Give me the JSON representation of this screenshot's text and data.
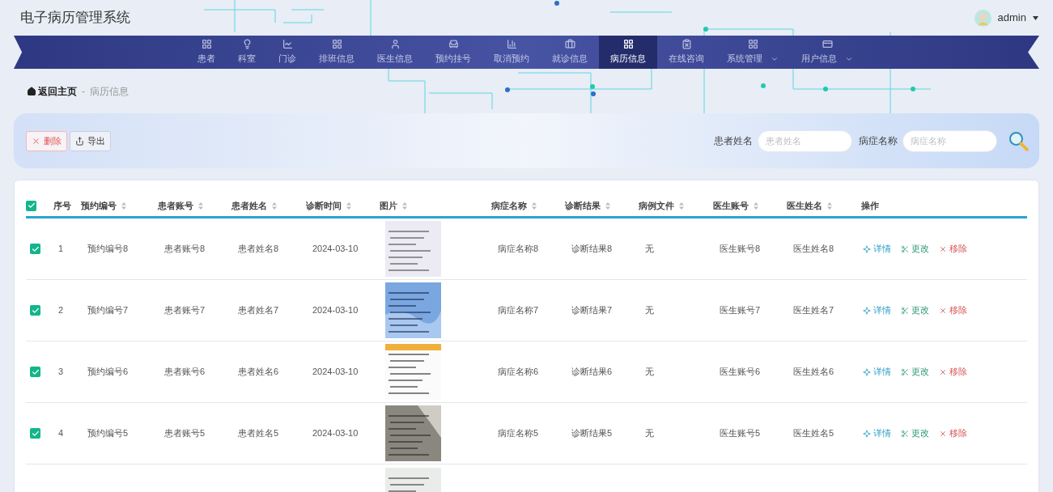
{
  "header": {
    "title": "电子病历管理系统",
    "user": "admin"
  },
  "nav": [
    {
      "label": "患者",
      "selected": false,
      "dropdown": false
    },
    {
      "label": "科室",
      "selected": false,
      "dropdown": false
    },
    {
      "label": "门诊",
      "selected": false,
      "dropdown": false
    },
    {
      "label": "排班信息",
      "selected": false,
      "dropdown": false
    },
    {
      "label": "医生信息",
      "selected": false,
      "dropdown": false
    },
    {
      "label": "预约挂号",
      "selected": false,
      "dropdown": false
    },
    {
      "label": "取消预约",
      "selected": false,
      "dropdown": false
    },
    {
      "label": "就诊信息",
      "selected": false,
      "dropdown": false
    },
    {
      "label": "病历信息",
      "selected": true,
      "dropdown": false
    },
    {
      "label": "在线咨询",
      "selected": false,
      "dropdown": false
    },
    {
      "label": "系统管理",
      "selected": false,
      "dropdown": true
    },
    {
      "label": "用户信息",
      "selected": false,
      "dropdown": true
    }
  ],
  "breadcrumb": {
    "home": "返回主页",
    "separator": "-",
    "current": "病历信息"
  },
  "toolbar": {
    "buttons": [
      {
        "label": "删除",
        "kind": "danger"
      },
      {
        "label": "导出",
        "kind": "export"
      }
    ],
    "filters": [
      {
        "label": "患者姓名",
        "placeholder": "患者姓名"
      },
      {
        "label": "病症名称",
        "placeholder": "病症名称"
      }
    ]
  },
  "table": {
    "all_checked": true,
    "columns": [
      {
        "label": "序号",
        "sortable": false
      },
      {
        "label": "预约编号",
        "sortable": true
      },
      {
        "label": "患者账号",
        "sortable": true
      },
      {
        "label": "患者姓名",
        "sortable": true
      },
      {
        "label": "诊断时间",
        "sortable": true
      },
      {
        "label": "图片",
        "sortable": true
      },
      {
        "label": "病症名称",
        "sortable": true
      },
      {
        "label": "诊断结果",
        "sortable": true
      },
      {
        "label": "病例文件",
        "sortable": true
      },
      {
        "label": "医生账号",
        "sortable": true
      },
      {
        "label": "医生姓名",
        "sortable": true
      },
      {
        "label": "操作",
        "sortable": false
      }
    ],
    "rows": [
      {
        "checked": true,
        "cells": [
          "1",
          "预约编号8",
          "患者账号8",
          "患者姓名8",
          "2024-03-10",
          {
            "kind": "picture"
          },
          "病症名称8",
          "诊断结果8",
          "无",
          "医生账号8",
          "医生姓名8"
        ],
        "actions": [
          "详情",
          "更改",
          "移除"
        ]
      },
      {
        "checked": true,
        "cells": [
          "2",
          "预约编号7",
          "患者账号7",
          "患者姓名7",
          "2024-03-10",
          {
            "kind": "picture"
          },
          "病症名称7",
          "诊断结果7",
          "无",
          "医生账号7",
          "医生姓名7"
        ],
        "actions": [
          "详情",
          "更改",
          "移除"
        ]
      },
      {
        "checked": true,
        "cells": [
          "3",
          "预约编号6",
          "患者账号6",
          "患者姓名6",
          "2024-03-10",
          {
            "kind": "picture"
          },
          "病症名称6",
          "诊断结果6",
          "无",
          "医生账号6",
          "医生姓名6"
        ],
        "actions": [
          "详情",
          "更改",
          "移除"
        ]
      },
      {
        "checked": true,
        "cells": [
          "4",
          "预约编号5",
          "患者账号5",
          "患者姓名5",
          "2024-03-10",
          {
            "kind": "picture"
          },
          "病症名称5",
          "诊断结果5",
          "无",
          "医生账号5",
          "医生姓名5"
        ],
        "actions": [
          "详情",
          "更改",
          "移除"
        ]
      },
      {
        "cells": [
          {
            "kind": "picture"
          }
        ]
      }
    ]
  }
}
